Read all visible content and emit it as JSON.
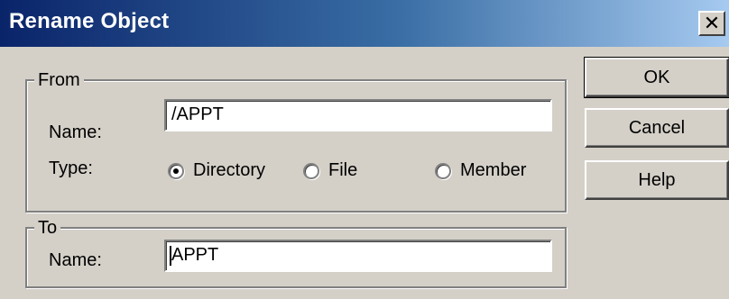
{
  "window": {
    "title": "Rename Object",
    "close_glyph": "✕"
  },
  "from_group": {
    "legend": "From",
    "name_label": "Name:",
    "name_value": "/APPT",
    "type_label": "Type:",
    "type_options": [
      {
        "label": "Directory",
        "selected": true
      },
      {
        "label": "File",
        "selected": false
      },
      {
        "label": "Member",
        "selected": false
      }
    ]
  },
  "to_group": {
    "legend": "To",
    "name_label": "Name:",
    "name_value": "APPT"
  },
  "buttons": {
    "ok": "OK",
    "cancel": "Cancel",
    "help": "Help"
  }
}
